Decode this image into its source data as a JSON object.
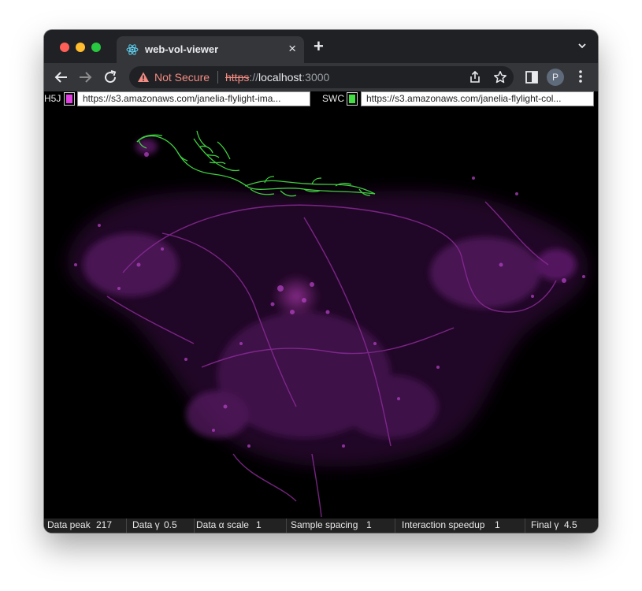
{
  "browser": {
    "tab_title": "web-vol-viewer",
    "tab_close": "×",
    "new_tab": "+",
    "security_label": "Not Secure",
    "url_scheme": "https",
    "url_sep": "://",
    "url_host": "localhost",
    "url_port": ":3000",
    "profile_initial": "P"
  },
  "viewer": {
    "h5j_label": "H5J",
    "h5j_color": "#e040e0",
    "h5j_url": "https://s3.amazonaws.com/janelia-flylight-ima...",
    "swc_label": "SWC",
    "swc_color": "#44dd44",
    "swc_url": "https://s3.amazonaws.com/janelia-flylight-col...",
    "volume_color": "#7a1f86",
    "neuron_color": "#3ecf3e"
  },
  "controls": [
    {
      "label": "Data peak",
      "value": "217"
    },
    {
      "label": "Data γ",
      "value": "0.5"
    },
    {
      "label": "Data α scale",
      "value": "1"
    },
    {
      "label": "Sample spacing",
      "value": "1"
    },
    {
      "label": "Interaction speedup",
      "value": "1"
    },
    {
      "label": "Final γ",
      "value": "4.5"
    }
  ]
}
